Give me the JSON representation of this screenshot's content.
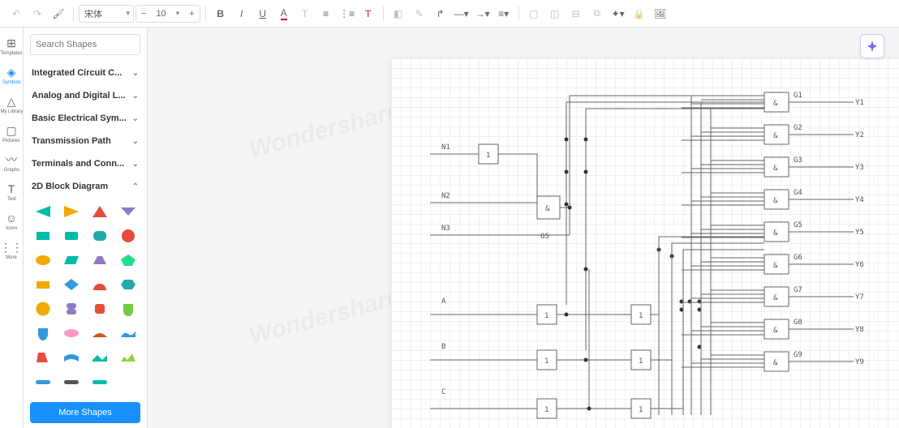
{
  "toolbar": {
    "font": "宋体",
    "size": "10"
  },
  "nav": [
    {
      "icon": "⊞",
      "label": "Templates"
    },
    {
      "icon": "◈",
      "label": "Symbols"
    },
    {
      "icon": "△",
      "label": "My Library"
    },
    {
      "icon": "▢",
      "label": "Pictures"
    },
    {
      "icon": "〰",
      "label": "Graphs"
    },
    {
      "icon": "T",
      "label": "Text"
    },
    {
      "icon": "☺",
      "label": "Icons"
    },
    {
      "icon": "⋮⋮⋮",
      "label": "More"
    }
  ],
  "search": {
    "placeholder": "Search Shapes"
  },
  "categories": [
    {
      "name": "Integrated Circuit C...",
      "open": false
    },
    {
      "name": "Analog and Digital L...",
      "open": false
    },
    {
      "name": "Basic Electrical Sym...",
      "open": false
    },
    {
      "name": "Transmission Path",
      "open": false
    },
    {
      "name": "Terminals and Conn...",
      "open": false
    },
    {
      "name": "2D Block Diagram",
      "open": true
    }
  ],
  "moreShapes": "More Shapes",
  "diagram": {
    "inputs": [
      "N1",
      "N2",
      "N3",
      "A",
      "B",
      "C"
    ],
    "gsLabel": "GS",
    "gates": [
      "G1",
      "G2",
      "G3",
      "G4",
      "G5",
      "G6",
      "G7",
      "G8",
      "G9"
    ],
    "outputs": [
      "Y1",
      "Y2",
      "Y3",
      "Y4",
      "Y5",
      "Y6",
      "Y7",
      "Y8",
      "Y9"
    ],
    "amp": "&",
    "one": "1",
    "watermark": "Wondershare EdrawMax"
  }
}
